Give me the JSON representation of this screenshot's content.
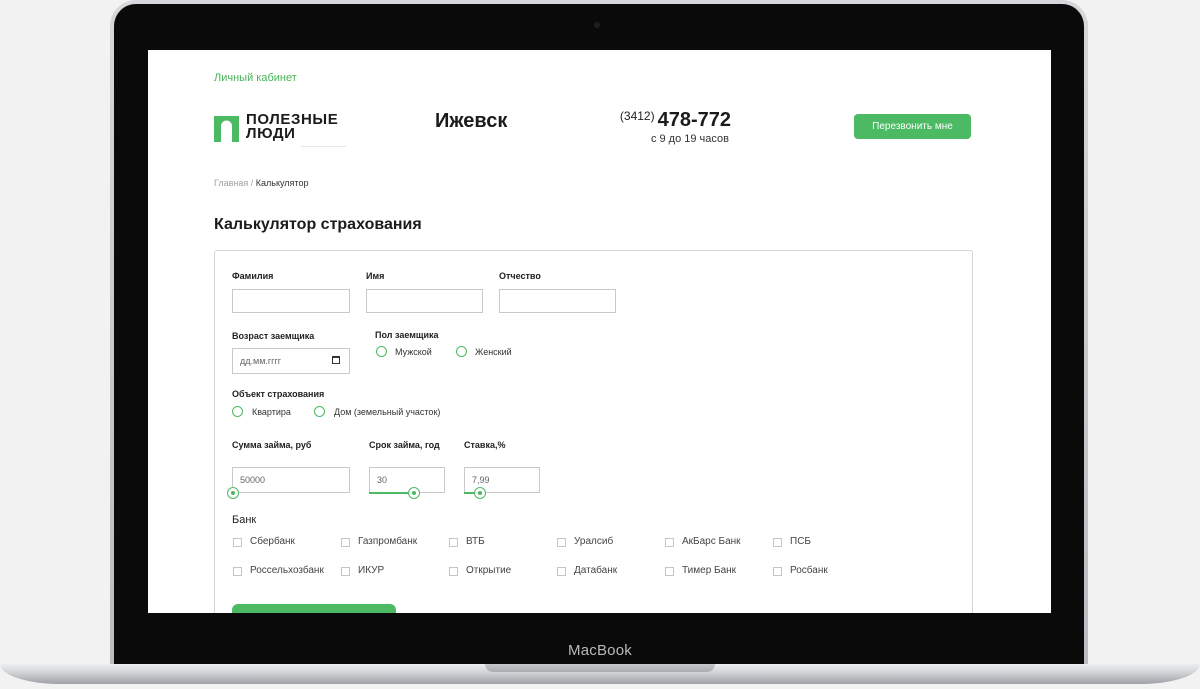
{
  "device": {
    "brand": "MacBook"
  },
  "header": {
    "cabinet_link": "Личный кабинет",
    "logo_line1": "ПОЛЕЗНЫЕ",
    "logo_line2": "ЛЮДИ",
    "city": "Ижевск",
    "phone_code": "(3412)",
    "phone_number": "478-772",
    "hours": "с 9 до 19 часов",
    "callback_button": "Перезвонить мне"
  },
  "breadcrumb": {
    "home": "Главная",
    "separator": " / ",
    "current": "Калькулятор"
  },
  "page_title": "Калькулятор страхования",
  "form": {
    "surname_label": "Фамилия",
    "surname_value": "",
    "name_label": "Имя",
    "name_value": "",
    "patronymic_label": "Отчество",
    "patronymic_value": "",
    "age_label": "Возраст заемщика",
    "age_placeholder": "дд.мм.гггг",
    "gender_label": "Пол заемщика",
    "gender_options": [
      "Мужской",
      "Женский"
    ],
    "object_label": "Объект страхования",
    "object_options": [
      "Квартира",
      "Дом (земельный участок)"
    ],
    "loan_amount_label": "Сумма займа, руб",
    "loan_amount_value": "50000",
    "loan_amount_slider": 0.0,
    "loan_term_label": "Срок займа, год",
    "loan_term_value": "30",
    "loan_term_slider": 0.58,
    "rate_label": "Ставка,%",
    "rate_value": "7,99",
    "rate_slider": 0.2,
    "bank_label": "Банк",
    "banks": [
      "Сбербанк",
      "Газпромбанк",
      "ВТБ",
      "Уралсиб",
      "АкБарс Банк",
      "ПСБ",
      "Россельхозбанк",
      "ИКУР",
      "Открытие",
      "Датабанк",
      "Тимер Банк",
      "Росбанк"
    ]
  },
  "colors": {
    "accent": "#4cb963",
    "link": "#49b35a"
  },
  "icons": {
    "logo": "logo-mark-icon",
    "calendar": "calendar-icon"
  }
}
